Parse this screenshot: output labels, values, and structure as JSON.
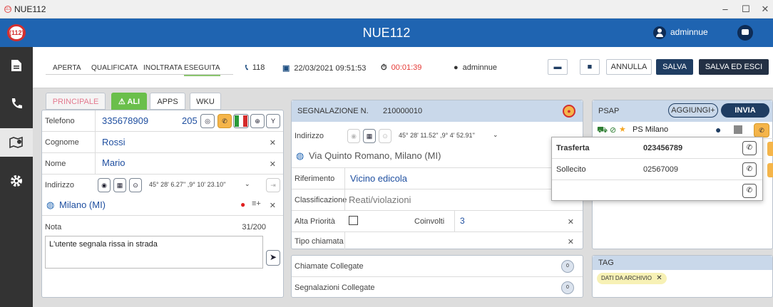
{
  "window": {
    "title": "NUE112",
    "minimize": "–",
    "maximize": "☐",
    "close": "✕"
  },
  "header": {
    "logo": "(112)",
    "title": "NUE112",
    "user": "adminnue"
  },
  "sidebar": {
    "items": [
      "document-icon",
      "phone-icon",
      "map-icon",
      "gear-icon"
    ]
  },
  "toolbar": {
    "steps": [
      "APERTA",
      "QUALIFICATA",
      "INOLTRATA",
      "ESEGUITA"
    ],
    "phone": "118",
    "date": "22/03/2021 09:51:53",
    "timer": "00:01:39",
    "user": "adminnue",
    "cancel": "ANNULLA",
    "save": "SALVA",
    "save_exit": "SALVA ED ESCI"
  },
  "left": {
    "tabs": [
      "PRINCIPALE",
      "⚠ ALI",
      "APPS",
      "WKU"
    ],
    "telefono_label": "Telefono",
    "telefono": "335678909",
    "telefono_code": "205",
    "cognome_label": "Cognome",
    "cognome": "Rossi",
    "nome_label": "Nome",
    "nome": "Mario",
    "indirizzo_label": "Indirizzo",
    "coords": "45° 28' 6.27'' ,9° 10' 23.10''",
    "city": "Milano (MI)",
    "nota_label": "Nota",
    "nota_count": "31/200",
    "nota": "L'utente segnala rissa in strada"
  },
  "center": {
    "header_label": "SEGNALAZIONE N.",
    "number": "210000010",
    "indirizzo_label": "Indirizzo",
    "coords": "45° 28' 11.52'' ,9° 4' 52.91''",
    "address": "Via Quinto Romano, Milano (MI)",
    "riferimento_label": "Riferimento",
    "riferimento": "Vicino edicola",
    "classificazione_label": "Classificazione",
    "classificazione": "Reati/violazioni",
    "alta_label": "Alta Priorità",
    "coinvolti_label": "Coinvolti",
    "coinvolti": "3",
    "tipo_label": "Tipo chiamata",
    "chiamate_label": "Chiamate Collegate",
    "chiamate_count": "0",
    "segnalazioni_label": "Segnalazioni Collegate",
    "segnalazioni_count": "0"
  },
  "psap": {
    "title": "PSAP",
    "add": "AGGIUNGI+",
    "send": "INVIA",
    "item": "PS Milano"
  },
  "popup": {
    "rows": [
      {
        "label": "Trasferta",
        "number": "023456789"
      },
      {
        "label": "Sollecito",
        "number": "02567009"
      },
      {
        "label": "",
        "number": ""
      }
    ]
  },
  "tag": {
    "title": "TAG",
    "chip": "DATI DA ARCHIVIO"
  },
  "colors": {
    "primary": "#1f64b1",
    "navy": "#1f3d62",
    "sidebar": "#333333",
    "alert": "#e53935",
    "accent_green": "#8ac56e"
  }
}
